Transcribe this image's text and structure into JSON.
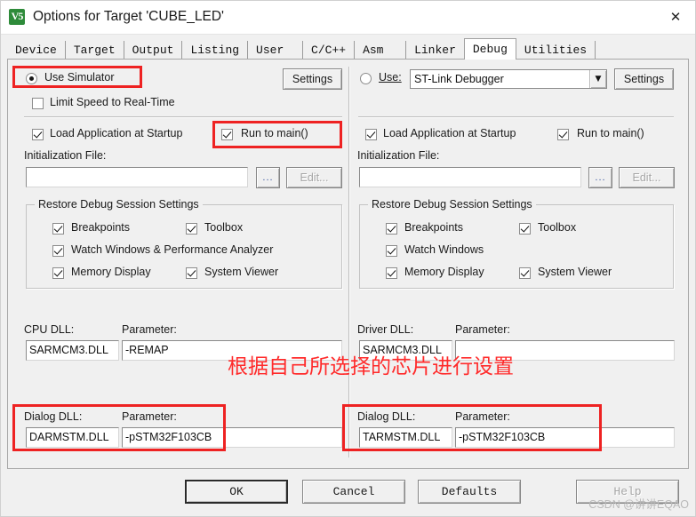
{
  "window": {
    "title": "Options for Target 'CUBE_LED'",
    "icon": "keil-uvision-icon",
    "close_label": "✕"
  },
  "tabs": [
    {
      "label": "Device",
      "selected": false
    },
    {
      "label": "Target",
      "selected": false
    },
    {
      "label": "Output",
      "selected": false
    },
    {
      "label": "Listing",
      "selected": false
    },
    {
      "label": "User",
      "selected": false
    },
    {
      "label": "C/C++",
      "selected": false
    },
    {
      "label": "Asm",
      "selected": false
    },
    {
      "label": "Linker",
      "selected": false
    },
    {
      "label": "Debug",
      "selected": true
    },
    {
      "label": "Utilities",
      "selected": false
    }
  ],
  "left_panel": {
    "use_simulator": {
      "label": "Use Simulator",
      "checked": true
    },
    "settings_button": "Settings",
    "limit_speed": {
      "label": "Limit Speed to Real-Time",
      "checked": false
    },
    "load_app": {
      "label": "Load Application at Startup",
      "checked": true
    },
    "run_to_main": {
      "label": "Run to main()",
      "checked": true
    },
    "init_file_label": "Initialization File:",
    "init_file_value": "",
    "browse_button": "...",
    "edit_button": "Edit...",
    "group_title": "Restore Debug Session Settings",
    "restore": [
      {
        "label": "Breakpoints",
        "checked": true
      },
      {
        "label": "Toolbox",
        "checked": true
      },
      {
        "label": "Watch Windows & Performance Analyzer",
        "checked": true
      },
      {
        "label": "Memory Display",
        "checked": true
      },
      {
        "label": "System Viewer",
        "checked": true
      }
    ],
    "cpu_dll_label": "CPU DLL:",
    "cpu_dll_value": "SARMCM3.DLL",
    "cpu_param_label": "Parameter:",
    "cpu_param_value": "-REMAP",
    "dialog_dll_label": "Dialog DLL:",
    "dialog_dll_value": "DARMSTM.DLL",
    "dialog_param_label": "Parameter:",
    "dialog_param_value": "-pSTM32F103CB"
  },
  "right_panel": {
    "use_radio": {
      "label": "Use:",
      "checked": false
    },
    "debugger_select": "ST-Link Debugger",
    "settings_button": "Settings",
    "load_app": {
      "label": "Load Application at Startup",
      "checked": true
    },
    "run_to_main": {
      "label": "Run to main()",
      "checked": true
    },
    "init_file_label": "Initialization File:",
    "init_file_value": "",
    "browse_button": "...",
    "edit_button": "Edit...",
    "group_title": "Restore Debug Session Settings",
    "restore": [
      {
        "label": "Breakpoints",
        "checked": true
      },
      {
        "label": "Toolbox",
        "checked": true
      },
      {
        "label": "Watch Windows",
        "checked": true
      },
      {
        "label": "Memory Display",
        "checked": true
      },
      {
        "label": "System Viewer",
        "checked": true
      }
    ],
    "driver_dll_label": "Driver DLL:",
    "driver_dll_value": "SARMCM3.DLL",
    "driver_param_label": "Parameter:",
    "driver_param_value": "",
    "dialog_dll_label": "Dialog DLL:",
    "dialog_dll_value": "TARMSTM.DLL",
    "dialog_param_label": "Parameter:",
    "dialog_param_value": "-pSTM32F103CB"
  },
  "footer": {
    "ok": "OK",
    "cancel": "Cancel",
    "defaults": "Defaults",
    "help": "Help",
    "watermark": "CSDN @讲讲EQAO"
  },
  "annotations": {
    "red_note": "根据自己所选择的芯片进行设置",
    "accent_color": "#ee2222"
  }
}
